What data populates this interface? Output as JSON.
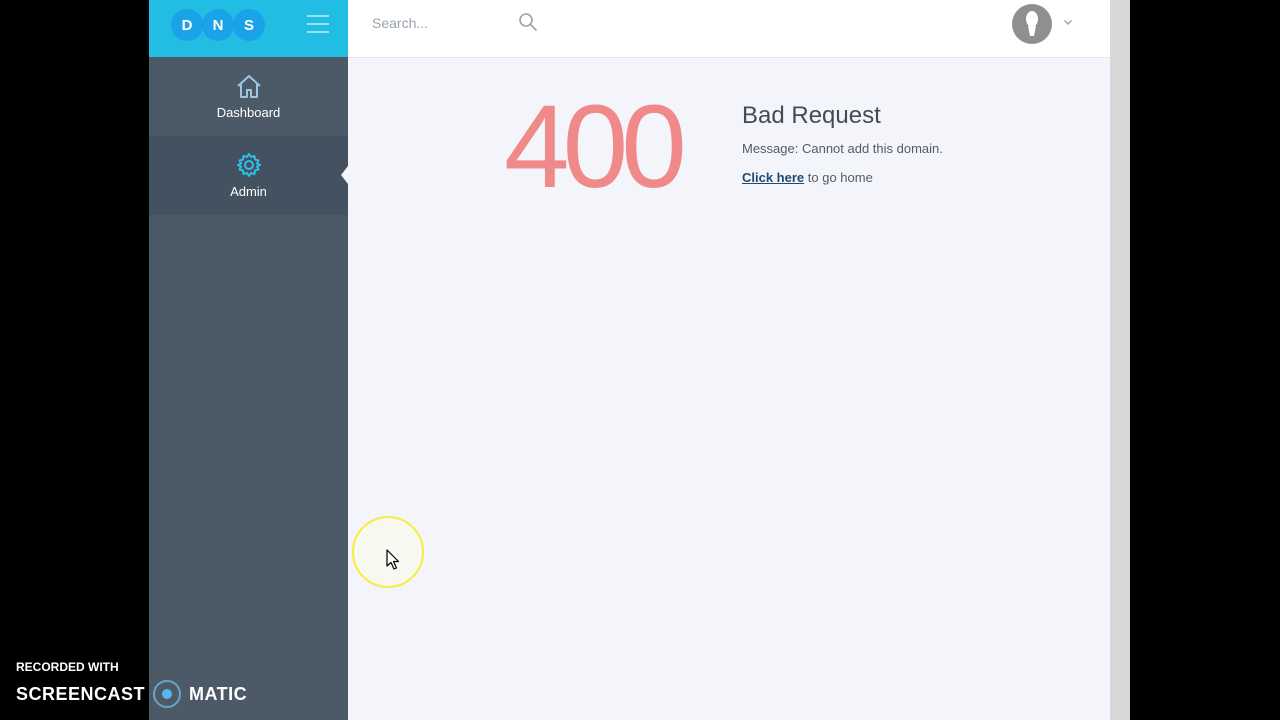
{
  "app": {
    "logo_letters": [
      "D",
      "N",
      "S"
    ],
    "colors": {
      "brand": "#22bde2",
      "sidebar": "#4c5a68",
      "error_code": "#f08a8a",
      "link": "#1f4a73"
    }
  },
  "sidebar": {
    "items": [
      {
        "label": "Dashboard",
        "icon": "home-icon",
        "active": false
      },
      {
        "label": "Admin",
        "icon": "gear-icon",
        "active": true
      }
    ]
  },
  "header": {
    "search": {
      "placeholder": "Search...",
      "value": ""
    },
    "icons": [
      "search-icon",
      "avatar",
      "chevron-down-icon"
    ]
  },
  "error": {
    "code": "400",
    "title": "Bad Request",
    "message": "Message: Cannot add this domain.",
    "home_link": "Click here",
    "home_suffix": " to go home"
  },
  "watermark": {
    "line1": "RECORDED WITH",
    "part1": "SCREENCAST",
    "part2": "MATIC"
  }
}
